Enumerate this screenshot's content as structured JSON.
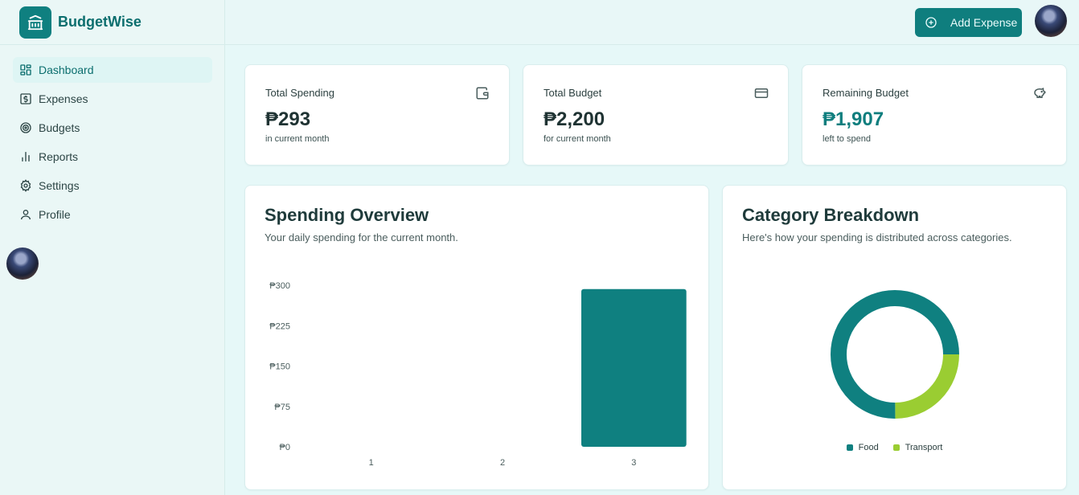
{
  "app": {
    "name": "BudgetWise"
  },
  "colors": {
    "primary": "#0f8080",
    "food": "#0f8080",
    "transport": "#9acd32"
  },
  "sidebar": {
    "items": [
      {
        "label": "Dashboard",
        "icon": "dashboard-icon",
        "active": true
      },
      {
        "label": "Expenses",
        "icon": "dollar-icon",
        "active": false
      },
      {
        "label": "Budgets",
        "icon": "target-icon",
        "active": false
      },
      {
        "label": "Reports",
        "icon": "bar-chart-icon",
        "active": false
      },
      {
        "label": "Settings",
        "icon": "gear-icon",
        "active": false
      },
      {
        "label": "Profile",
        "icon": "user-icon",
        "active": false
      }
    ]
  },
  "header": {
    "add_expense_label": "Add Expense"
  },
  "stats": [
    {
      "title": "Total Spending",
      "value": "₱293",
      "sub": "in current month",
      "icon": "wallet-icon"
    },
    {
      "title": "Total Budget",
      "value": "₱2,200",
      "sub": "for current month",
      "icon": "credit-card-icon"
    },
    {
      "title": "Remaining Budget",
      "value": "₱1,907",
      "sub": "left to spend",
      "icon": "piggy-bank-icon"
    }
  ],
  "spending": {
    "title": "Spending Overview",
    "description": "Your daily spending for the current month."
  },
  "breakdown": {
    "title": "Category Breakdown",
    "description": "Here's how your spending is distributed across categories."
  },
  "chart_data": [
    {
      "type": "bar",
      "categories": [
        "1",
        "2",
        "3"
      ],
      "values": [
        0,
        0,
        293
      ],
      "ylim": [
        0,
        300
      ],
      "yticks": [
        "₱0",
        "₱75",
        "₱150",
        "₱225",
        "₱300"
      ],
      "ytick_values": [
        0,
        75,
        150,
        225,
        300
      ],
      "grid": false
    },
    {
      "type": "pie",
      "donut": true,
      "categories": [
        "Food",
        "Transport"
      ],
      "values": [
        220,
        73
      ],
      "colors": [
        "#0f8080",
        "#9acd32"
      ],
      "legend": "bottom"
    }
  ]
}
